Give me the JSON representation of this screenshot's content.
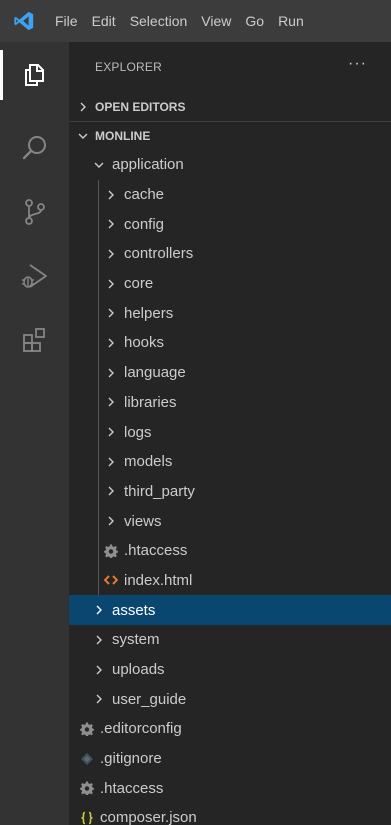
{
  "menu": {
    "items": [
      "File",
      "Edit",
      "Selection",
      "View",
      "Go",
      "Run"
    ]
  },
  "explorer": {
    "title": "EXPLORER",
    "more": "···",
    "open_editors": "OPEN EDITORS",
    "root": "MONLINE"
  },
  "tree": {
    "application": "application",
    "app_children": [
      "cache",
      "config",
      "controllers",
      "core",
      "helpers",
      "hooks",
      "language",
      "libraries",
      "logs",
      "models",
      "third_party",
      "views"
    ],
    "htaccess_app": ".htaccess",
    "index_html": "index.html",
    "root_folders": [
      "assets",
      "system",
      "uploads",
      "user_guide"
    ],
    "root_files": [
      ".editorconfig",
      ".gitignore",
      ".htaccess",
      "composer.json"
    ]
  },
  "colors": {
    "selection": "#094771",
    "vscode_blue": "#3ea2f3",
    "html_orange": "#e37933",
    "json_yellow": "#cbcb41",
    "gear_gray": "#8e8e8e"
  }
}
